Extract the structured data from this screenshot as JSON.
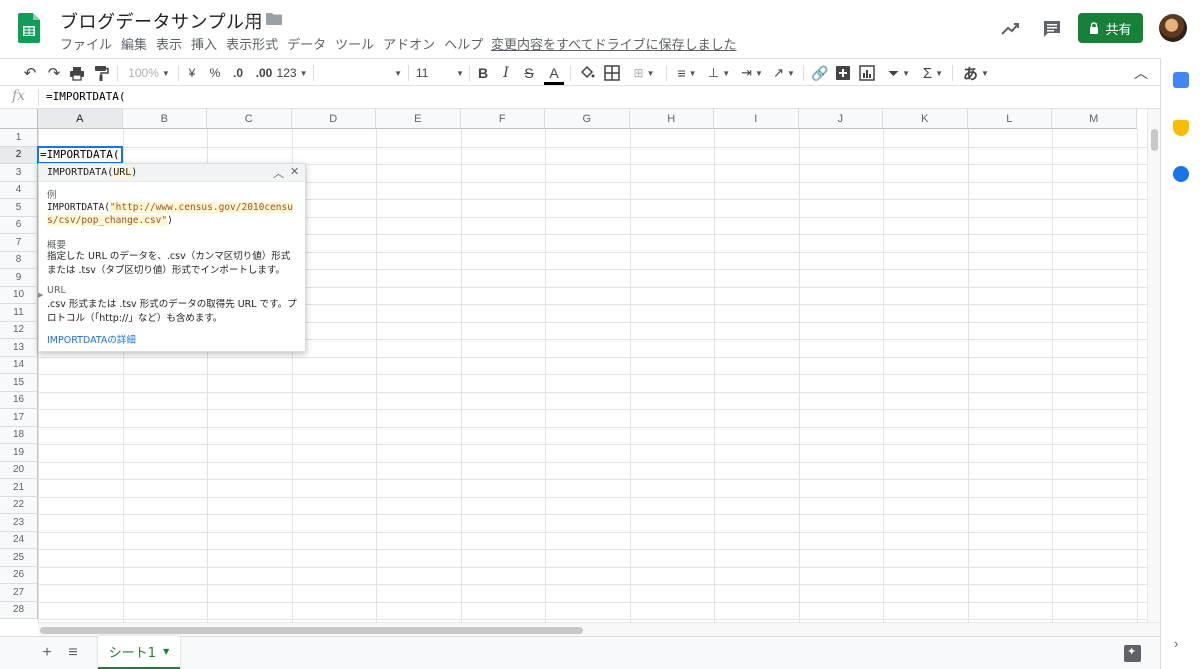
{
  "header": {
    "title": "ブログデータサンプル用",
    "menu": [
      "ファイル",
      "編集",
      "表示",
      "挿入",
      "表示形式",
      "データ",
      "ツール",
      "アドオン",
      "ヘルプ"
    ],
    "save_status": "変更内容をすべてドライブに保存しました",
    "share_label": "共有"
  },
  "toolbar": {
    "zoom": "100%",
    "currency": "¥",
    "percent": "%",
    "decimal_decrease": ".0",
    "decimal_increase": ".00",
    "format_more": "123",
    "font_size": "11",
    "input_tool": "あ"
  },
  "formula_bar": {
    "fx_label": "fx",
    "content": "=IMPORTDATA("
  },
  "grid": {
    "columns": [
      "A",
      "B",
      "C",
      "D",
      "E",
      "F",
      "G",
      "H",
      "I",
      "J",
      "K",
      "L",
      "M"
    ],
    "rows": [
      "1",
      "2",
      "3",
      "4",
      "5",
      "6",
      "7",
      "8",
      "9",
      "10",
      "11",
      "12",
      "13",
      "14",
      "15",
      "16",
      "17",
      "18",
      "19",
      "20",
      "21",
      "22",
      "23",
      "24",
      "25",
      "26",
      "27",
      "28"
    ],
    "active_cell_value": "=IMPORTDATA("
  },
  "help_popup": {
    "function_name": "IMPORTDATA(",
    "argument": "URL",
    "close_paren": ")",
    "example_label": "例",
    "example_prefix": "IMPORTDATA(",
    "example_string": "\"http://www.census.gov/2010census/csv/pop_change.csv\"",
    "example_suffix": ")",
    "summary_label": "概要",
    "summary_text": "指定した URL のデータを、.csv（カンマ区切り値）形式または .tsv（タブ区切り値）形式でインポートします。",
    "arg_label": "URL",
    "arg_text": ".csv 形式または .tsv 形式のデータの取得先 URL です。プロトコル（「http://」など）も含めます。",
    "learn_more": "IMPORTDATAの詳細"
  },
  "bottom_bar": {
    "sheet_tab": "シート1"
  },
  "colors": {
    "accent_green": "#188038",
    "selection_blue": "#1a73e8",
    "highlight_yellow": "#fef7d3"
  }
}
